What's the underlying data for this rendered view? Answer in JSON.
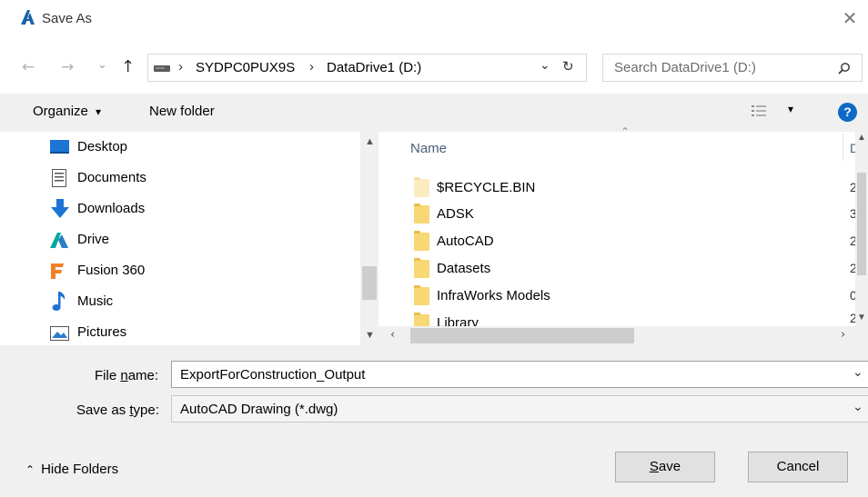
{
  "window": {
    "title": "Save As",
    "close_glyph": "✕"
  },
  "nav": {
    "back": "←",
    "forward": "→",
    "recent": "⌄",
    "up": "↑"
  },
  "address": {
    "crumbs": [
      "SYDPC0PUX9S",
      "DataDrive1 (D:)"
    ],
    "separator": "›"
  },
  "search": {
    "placeholder": "Search DataDrive1 (D:)"
  },
  "toolbar": {
    "organize": "Organize",
    "organize_arrow": "▾",
    "new_folder": "New folder",
    "view_arrow": "▾",
    "help": "?"
  },
  "sidebar": {
    "items": [
      {
        "label": "Desktop",
        "icon": "desktop-icon"
      },
      {
        "label": "Documents",
        "icon": "documents-icon"
      },
      {
        "label": "Downloads",
        "icon": "downloads-icon"
      },
      {
        "label": "Drive",
        "icon": "autodesk-drive-icon"
      },
      {
        "label": "Fusion 360",
        "icon": "fusion360-icon"
      },
      {
        "label": "Music",
        "icon": "music-icon"
      },
      {
        "label": "Pictures",
        "icon": "pictures-icon"
      }
    ]
  },
  "filelist": {
    "column_name": "Name",
    "column_date_fragment": "D",
    "rows": [
      {
        "name": "$RECYCLE.BIN",
        "date_fragment": "2",
        "hidden": true
      },
      {
        "name": "ADSK",
        "date_fragment": "3",
        "hidden": false
      },
      {
        "name": "AutoCAD",
        "date_fragment": "2",
        "hidden": false
      },
      {
        "name": "Datasets",
        "date_fragment": "2",
        "hidden": false
      },
      {
        "name": "InfraWorks Models",
        "date_fragment": "0",
        "hidden": false
      },
      {
        "name": "Library",
        "date_fragment": "2",
        "hidden": false
      }
    ]
  },
  "form": {
    "file_name_label_pre": "File ",
    "file_name_label_u": "n",
    "file_name_label_post": "ame:",
    "file_name_value": "ExportForConstruction_Output",
    "type_label_pre": "Save as ",
    "type_label_u": "t",
    "type_label_post": "ype:",
    "type_value": "AutoCAD Drawing (*.dwg)"
  },
  "footer": {
    "hide_folders": "Hide Folders",
    "save_u": "S",
    "save_rest": "ave",
    "cancel": "Cancel"
  },
  "colors": {
    "help_blue": "#0e6ac4",
    "autocad_red": "#c8102e",
    "fusion_orange": "#f08223",
    "accent_blue": "#1e74d4"
  }
}
